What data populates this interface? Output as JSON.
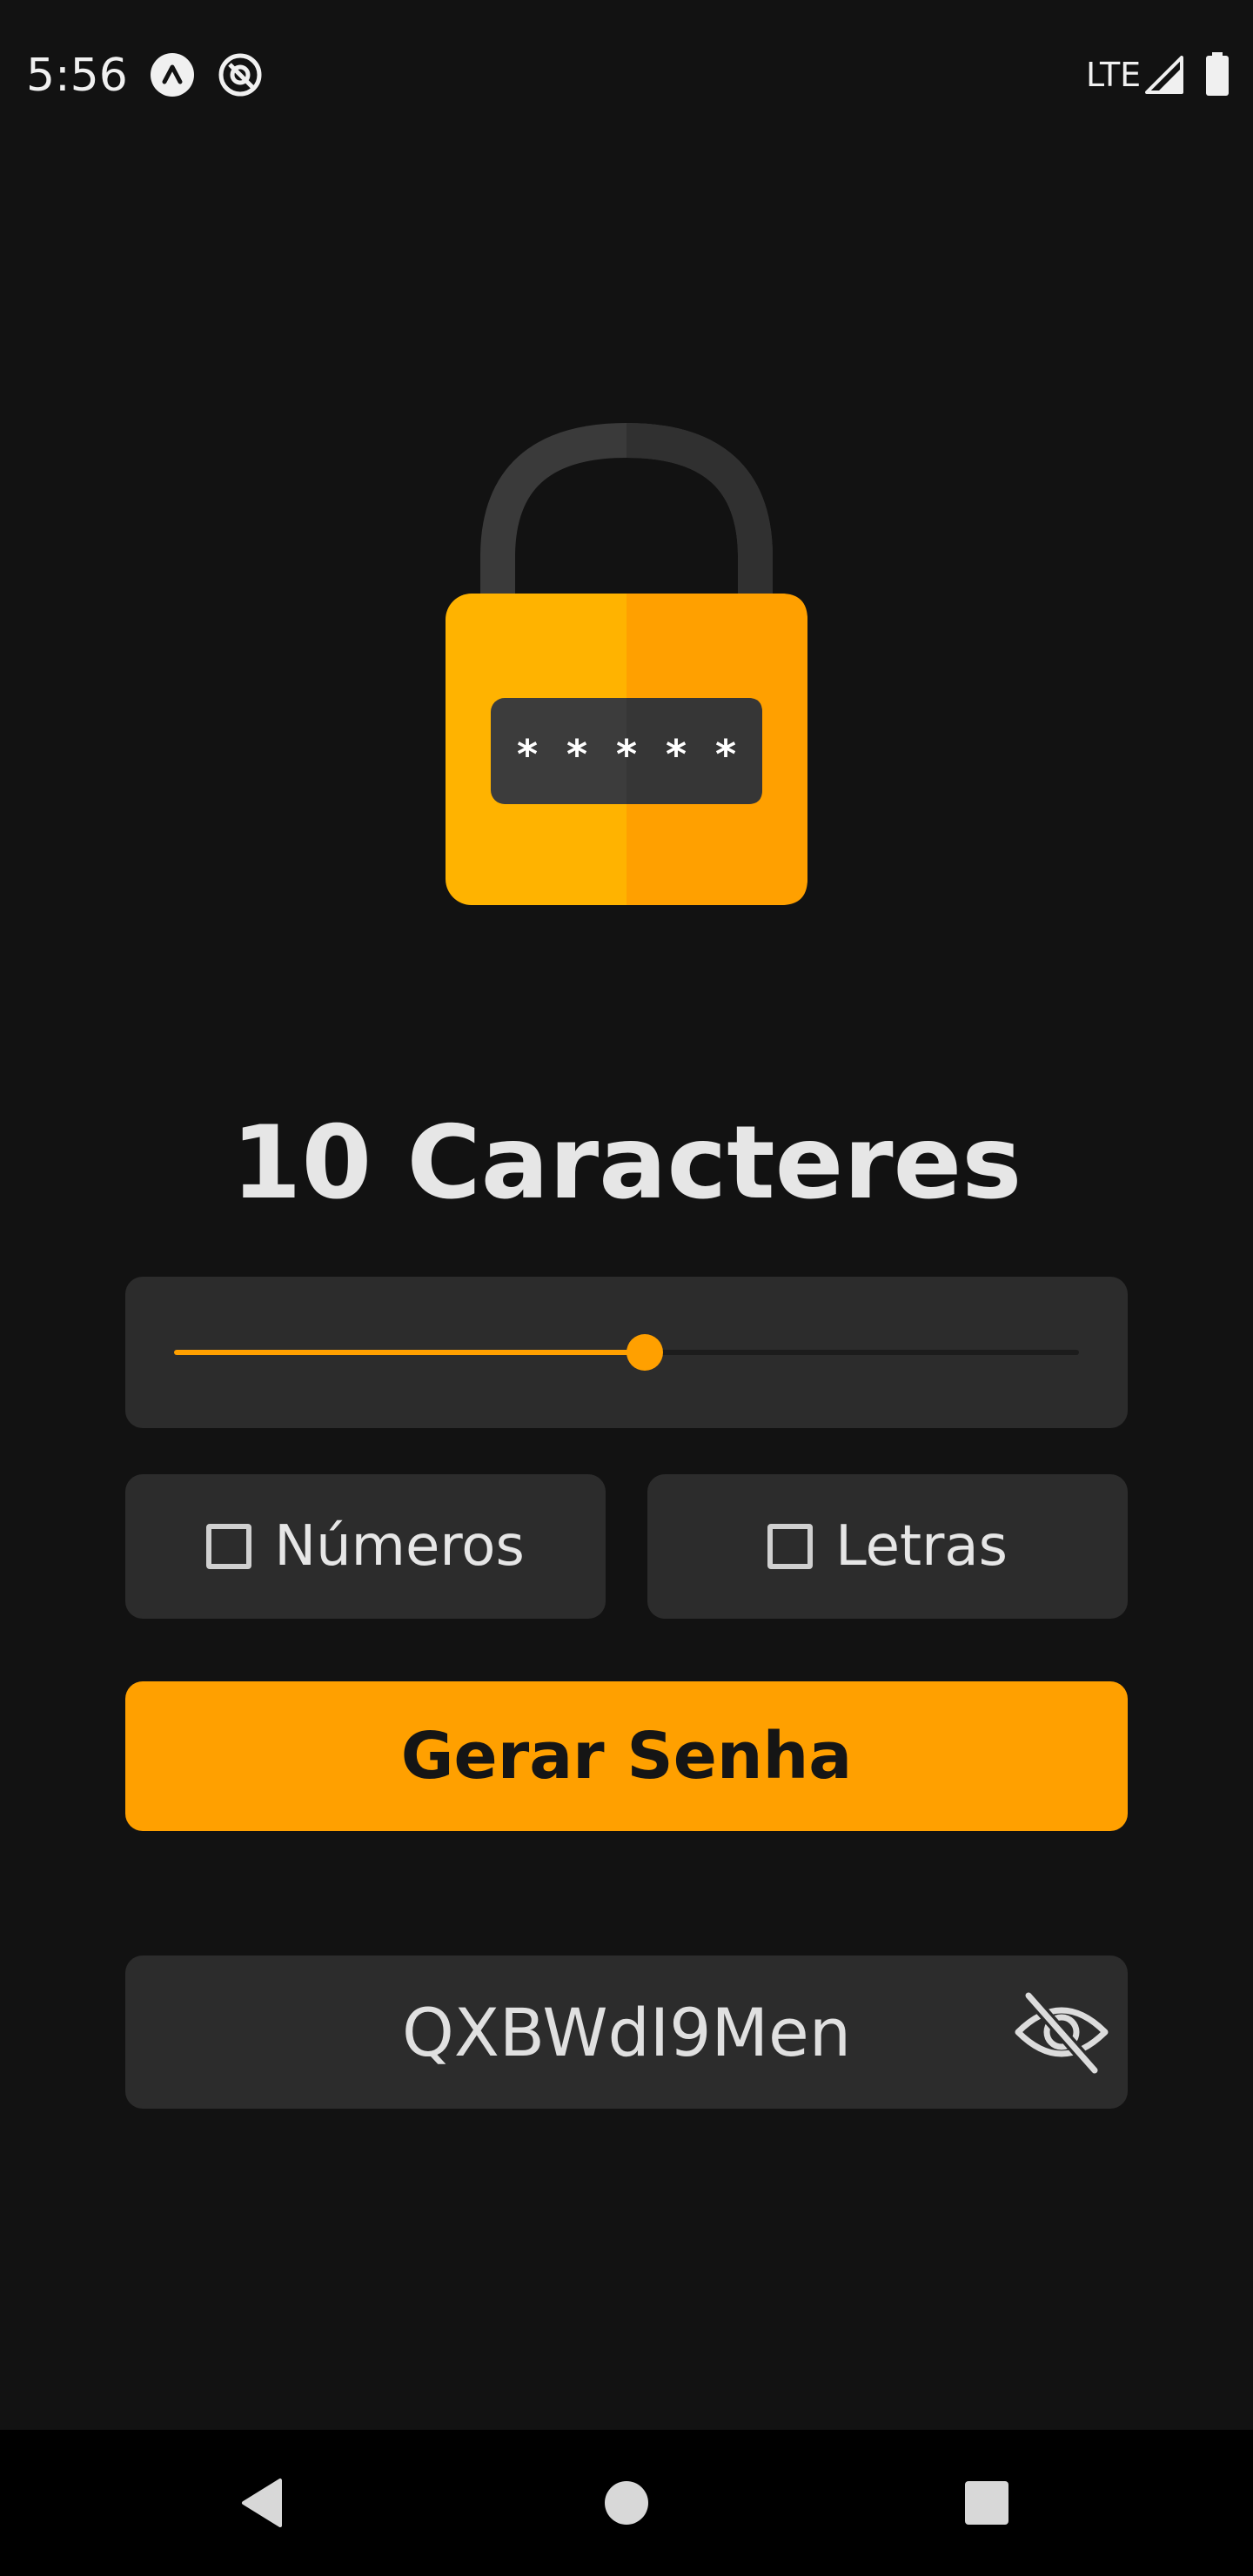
{
  "status_bar": {
    "time": "5:56",
    "network": "LTE",
    "icons": [
      "app-notification-icon",
      "at-sign-notification-icon",
      "signal-icon",
      "battery-icon"
    ]
  },
  "illustration": {
    "icon": "padlock-password-icon",
    "body_color": "#FFB300",
    "shackle_color": "#3a3a3a"
  },
  "generator": {
    "title": "10 Caracteres",
    "length": 10,
    "slider_fraction": 0.52,
    "accent_color": "#FFA000",
    "options": [
      {
        "label": "Números",
        "checked": false
      },
      {
        "label": "Letras",
        "checked": false
      }
    ],
    "generate_label": "Gerar Senha",
    "password": "QXBWdI9Men",
    "visibility_icon": "eye-off-icon"
  },
  "nav_bar": {
    "icons": [
      "back-icon",
      "home-icon",
      "recents-icon"
    ]
  }
}
